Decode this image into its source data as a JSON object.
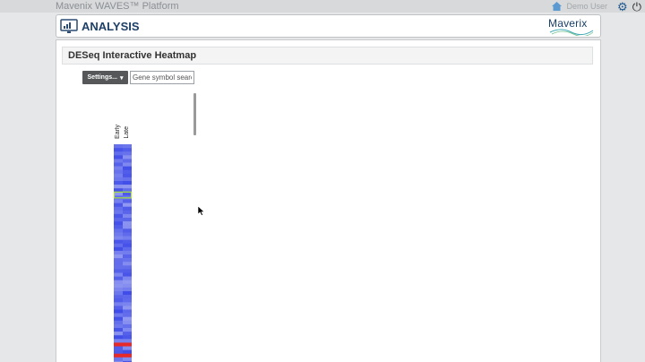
{
  "platform": {
    "brand": "Mavenix WAVES™ Platform",
    "user_label": "Demo User"
  },
  "icons": {
    "home": "home-icon",
    "gear": "gear-icon",
    "power": "power-icon",
    "analysis": "monitor-chart-icon",
    "cursor": "mouse-pointer-icon"
  },
  "header": {
    "title": "ANALYSIS",
    "logo_text": "Maverix"
  },
  "panel": {
    "title": "DESeq Interactive Heatmap",
    "settings_label": "Settings...",
    "search_placeholder": "Gene symbol search"
  },
  "heatmap": {
    "columns": [
      "Early",
      "Late"
    ],
    "row_count": 60,
    "colors": {
      "low": "#3e4be8",
      "mid": "#c9cdf7",
      "high": "#e8292a",
      "highlight": "#a6e23c"
    },
    "highlighted_rows": [
      13
    ],
    "red_rows": [
      54,
      57
    ]
  }
}
